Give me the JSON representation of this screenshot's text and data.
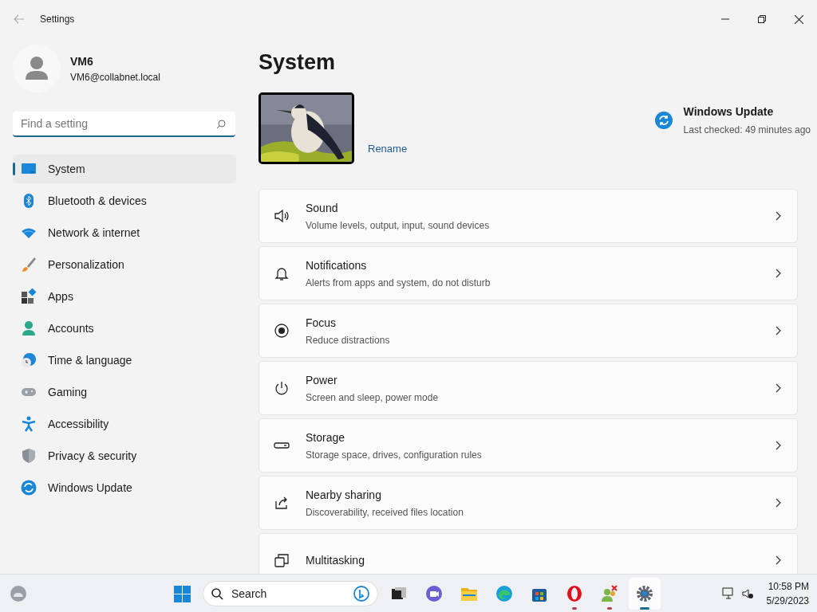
{
  "window": {
    "title": "Settings"
  },
  "user": {
    "name": "VM6",
    "email": "VM6@collabnet.local"
  },
  "search": {
    "placeholder": "Find a setting"
  },
  "sidebar": {
    "items": [
      {
        "label": "System",
        "selected": true
      },
      {
        "label": "Bluetooth & devices",
        "selected": false
      },
      {
        "label": "Network & internet",
        "selected": false
      },
      {
        "label": "Personalization",
        "selected": false
      },
      {
        "label": "Apps",
        "selected": false
      },
      {
        "label": "Accounts",
        "selected": false
      },
      {
        "label": "Time & language",
        "selected": false
      },
      {
        "label": "Gaming",
        "selected": false
      },
      {
        "label": "Accessibility",
        "selected": false
      },
      {
        "label": "Privacy & security",
        "selected": false
      },
      {
        "label": "Windows Update",
        "selected": false
      }
    ]
  },
  "page": {
    "title": "System",
    "rename": "Rename",
    "update": {
      "title": "Windows Update",
      "status": "Last checked: 49 minutes ago"
    }
  },
  "settings": [
    {
      "title": "Sound",
      "subtitle": "Volume levels, output, input, sound devices"
    },
    {
      "title": "Notifications",
      "subtitle": "Alerts from apps and system, do not disturb"
    },
    {
      "title": "Focus",
      "subtitle": "Reduce distractions"
    },
    {
      "title": "Power",
      "subtitle": "Screen and sleep, power mode"
    },
    {
      "title": "Storage",
      "subtitle": "Storage space, drives, configuration rules"
    },
    {
      "title": "Nearby sharing",
      "subtitle": "Discoverability, received files location"
    },
    {
      "title": "Multitasking"
    }
  ],
  "taskbar": {
    "search": "Search",
    "apps": [
      {
        "running": false,
        "selected": false
      },
      {
        "running": false,
        "selected": false
      },
      {
        "running": false,
        "selected": false
      },
      {
        "running": false,
        "selected": false
      },
      {
        "running": false,
        "selected": false
      },
      {
        "running": false,
        "selected": false
      },
      {
        "running": true,
        "selected": false
      },
      {
        "running": true,
        "selected": false
      },
      {
        "running": true,
        "selected": true
      }
    ],
    "time": "10:58 PM",
    "date": "5/29/2023"
  }
}
